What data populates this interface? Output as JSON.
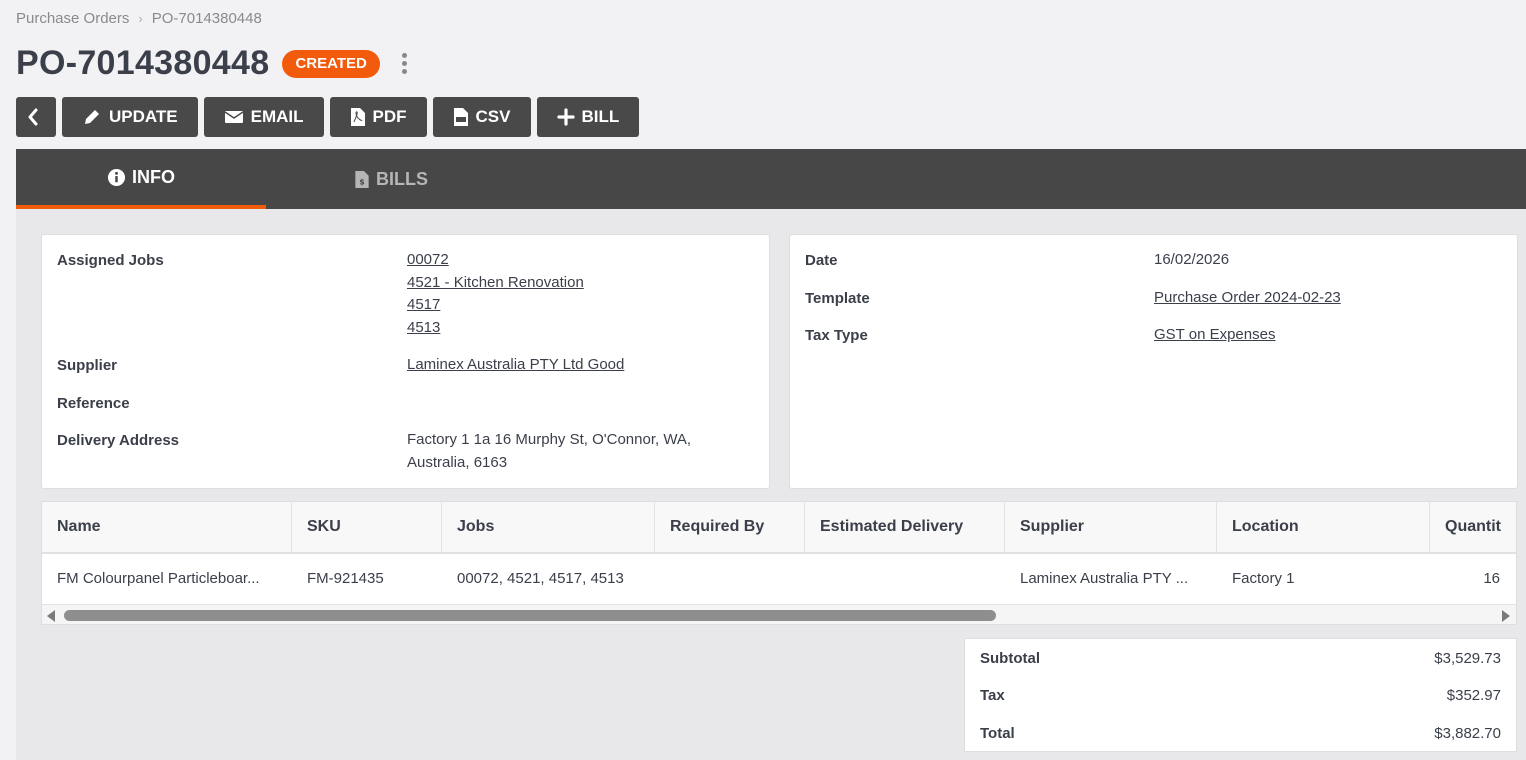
{
  "breadcrumb": {
    "parent": "Purchase Orders",
    "current": "PO-7014380448"
  },
  "header": {
    "title": "PO-7014380448",
    "status": "CREATED"
  },
  "toolbar": {
    "update": "UPDATE",
    "email": "EMAIL",
    "pdf": "PDF",
    "csv": "CSV",
    "bill": "BILL"
  },
  "tabs": {
    "info": "INFO",
    "bills": "BILLS"
  },
  "info_left": {
    "assigned_jobs_label": "Assigned Jobs",
    "assigned_jobs": [
      "00072",
      "4521 - Kitchen Renovation",
      "4517",
      "4513"
    ],
    "supplier_label": "Supplier",
    "supplier": "Laminex Australia PTY Ltd Good",
    "reference_label": "Reference",
    "reference": "",
    "delivery_label": "Delivery Address",
    "delivery_line1": "Factory 1 1a 16 Murphy St, O'Connor, WA,",
    "delivery_line2": "Australia, 6163"
  },
  "info_right": {
    "date_label": "Date",
    "date": "16/02/2026",
    "template_label": "Template",
    "template": "Purchase Order 2024-02-23",
    "tax_type_label": "Tax Type",
    "tax_type": "GST on Expenses"
  },
  "table": {
    "headers": [
      "Name",
      "SKU",
      "Jobs",
      "Required By",
      "Estimated Delivery",
      "Supplier",
      "Location",
      "Quantit"
    ],
    "rows": [
      {
        "name": "FM Colourpanel Particleboar...",
        "sku": "FM-921435",
        "jobs": "00072, 4521, 4517, 4513",
        "required_by": "",
        "estimated_delivery": "",
        "supplier": "Laminex Australia PTY ...",
        "location": "Factory 1",
        "quantity": "16"
      }
    ]
  },
  "totals": {
    "subtotal_label": "Subtotal",
    "subtotal": "$3,529.73",
    "tax_label": "Tax",
    "tax": "$352.97",
    "total_label": "Total",
    "total": "$3,882.70"
  },
  "colors": {
    "accent": "#f25a0c",
    "dark": "#474747",
    "button": "#494949"
  }
}
